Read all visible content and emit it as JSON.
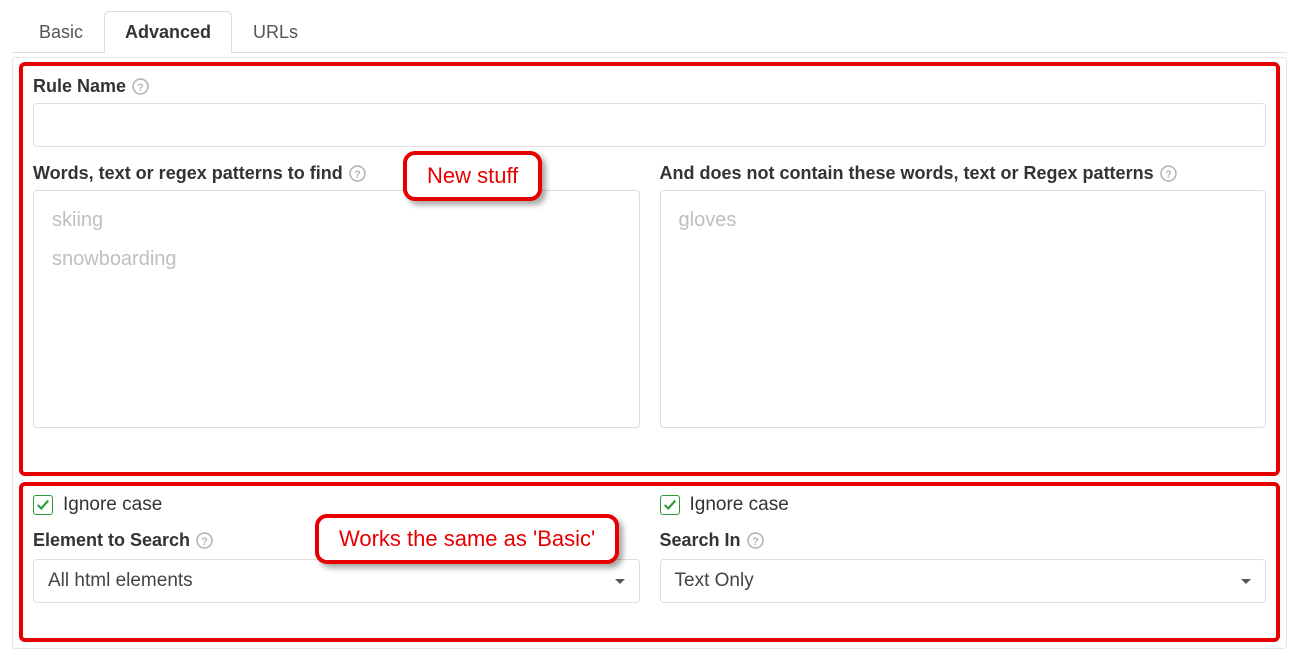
{
  "tabs": {
    "basic": "Basic",
    "advanced": "Advanced",
    "urls": "URLs"
  },
  "top": {
    "rule_name_label": "Rule Name",
    "rule_name_value": "",
    "words_find_label": "Words, text or regex patterns to find",
    "words_find_tags": [
      "skiing",
      "snowboarding"
    ],
    "not_contain_label": "And does not contain these words, text or Regex patterns",
    "not_contain_tags": [
      "gloves"
    ]
  },
  "callouts": {
    "new_stuff": "New stuff",
    "works_same": "Works the same as 'Basic'"
  },
  "bottom": {
    "left": {
      "ignore_case_label": "Ignore case",
      "ignore_case_checked": true,
      "element_to_search_label": "Element to Search",
      "element_to_search_value": "All html elements"
    },
    "right": {
      "ignore_case_label": "Ignore case",
      "ignore_case_checked": true,
      "search_in_label": "Search In",
      "search_in_value": "Text Only"
    }
  }
}
